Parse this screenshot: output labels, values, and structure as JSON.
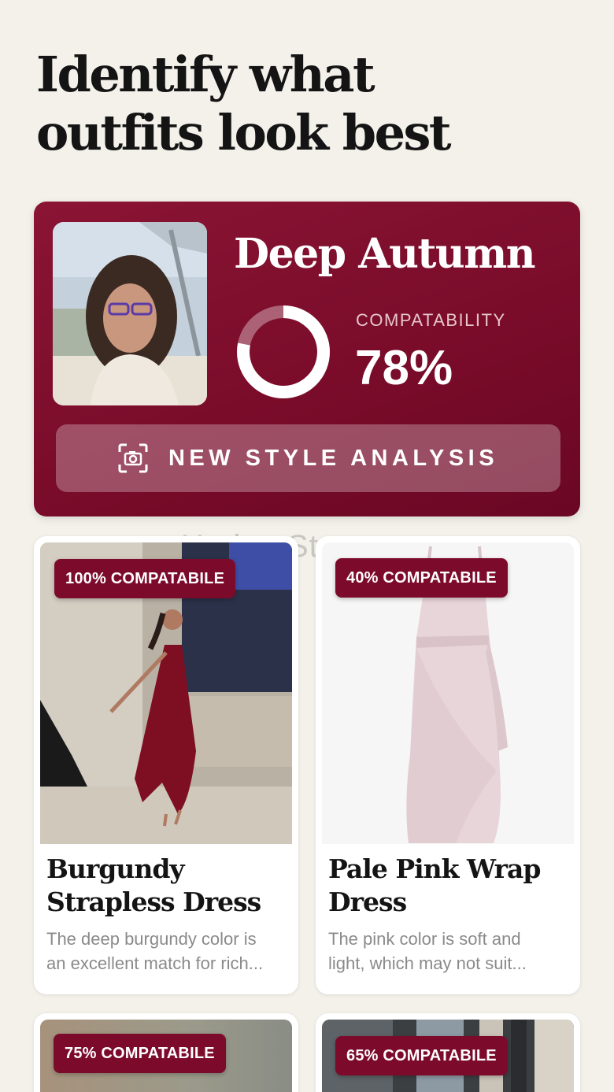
{
  "header": {
    "title": "Identify what outfits look best"
  },
  "analysis": {
    "season": "Deep Autumn",
    "compatibility_label": "COMPATABILITY",
    "compatibility_value": "78%",
    "compatibility_percent": 78,
    "button_label": "NEW STYLE ANALYSIS"
  },
  "outfits": [
    {
      "badge": "100% COMPATABILE",
      "title": "Burgundy Strapless Dress",
      "desc_line1": "The deep burgundy color is",
      "desc_line2": "an excellent match for rich..."
    },
    {
      "badge": "40% COMPATABILE",
      "title": "Pale Pink Wrap Dress",
      "desc_line1": "The pink color is soft and",
      "desc_line2": "light, which may not suit..."
    },
    {
      "badge": "75% COMPATABILE"
    },
    {
      "badge": "65% COMPATABILE"
    }
  ],
  "watermark": "UpdateStar.com",
  "colors": {
    "accent": "#7c0b2b",
    "background": "#f3f1ea"
  }
}
